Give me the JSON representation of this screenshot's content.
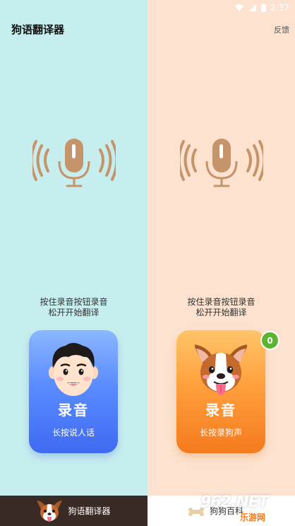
{
  "status": {
    "time": "2:37",
    "icons": [
      "wifi-icon",
      "signal-icon",
      "battery-icon"
    ]
  },
  "app": {
    "title": "狗语翻译器",
    "feedback": "反馈"
  },
  "colors": {
    "left_panel": "#c7eeee",
    "right_panel": "#fde3cf",
    "mic": "#c6946a",
    "human_button": "#4f7dff",
    "dog_button": "#ff8f2e",
    "badge": "#5fb332",
    "bottom_active": "#3a2a26"
  },
  "human": {
    "instruction_line1": "按住录音按钮录音",
    "instruction_line2": "松开开始翻译",
    "button_title": "录音",
    "button_sub": "长按说人话"
  },
  "dog": {
    "instruction_line1": "按住录音按钮录音",
    "instruction_line2": "松开开始翻译",
    "button_title": "录音",
    "button_sub": "长按录狗声",
    "badge_count": "0"
  },
  "bottom_nav": {
    "tab_translator": "狗语翻译器",
    "tab_second_partial": "狗狗百科"
  },
  "watermark": {
    "logo": "962.NET",
    "sub": "乐游网"
  }
}
